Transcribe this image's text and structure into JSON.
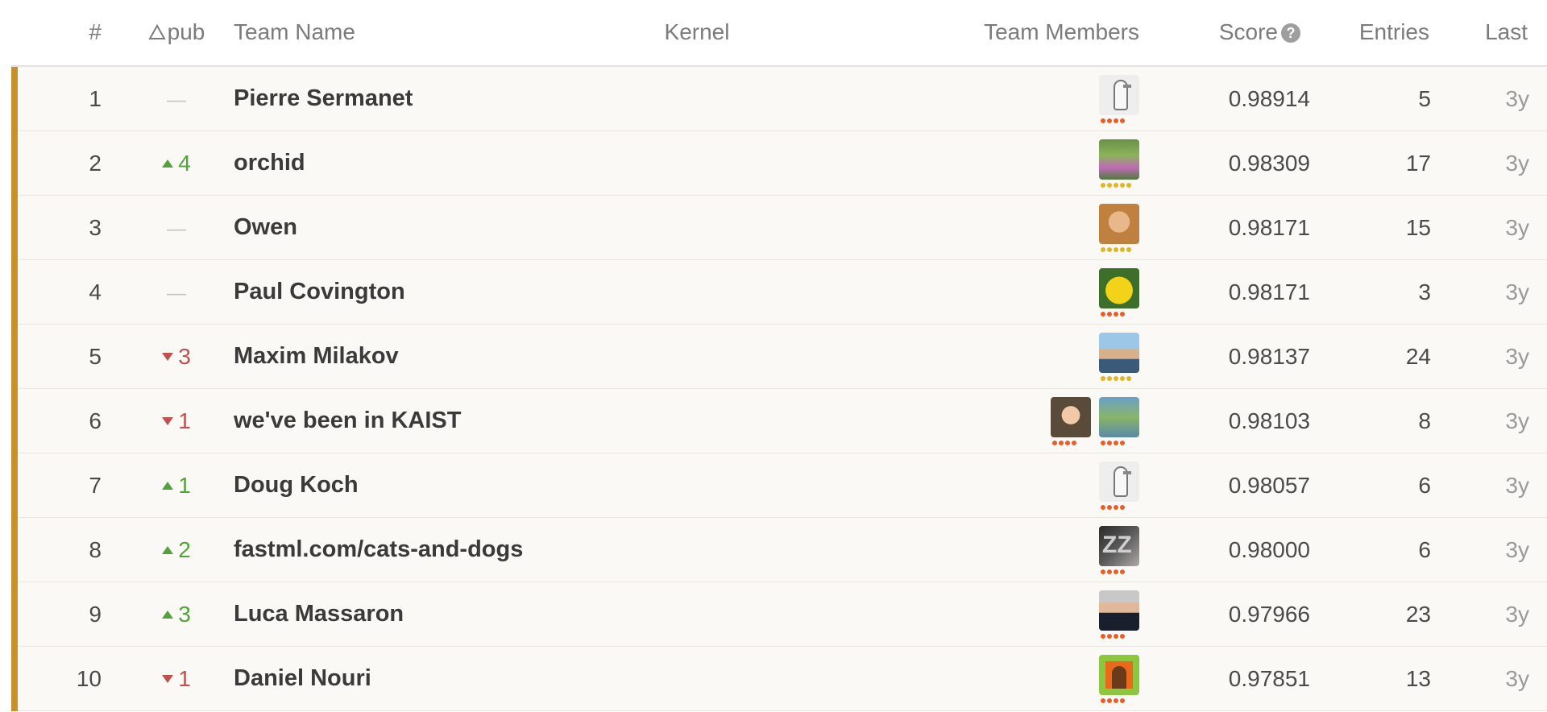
{
  "header": {
    "rank": "#",
    "delta": "pub",
    "team_name": "Team Name",
    "kernel": "Kernel",
    "team_members": "Team Members",
    "score": "Score",
    "entries": "Entries",
    "last": "Last",
    "help_glyph": "?"
  },
  "colors": {
    "gold_highlight": "#c4912a",
    "up": "#52a43a",
    "down": "#c0504d",
    "tier_orange": "#e85d2a",
    "tier_gold": "#e0b526"
  },
  "rows": [
    {
      "rank": "1",
      "delta_dir": "none",
      "delta": "—",
      "team": "Pierre Sermanet",
      "score": "0.98914",
      "entries": "5",
      "last": "3y",
      "members": [
        {
          "avatar": "goose",
          "tier": "orange"
        }
      ]
    },
    {
      "rank": "2",
      "delta_dir": "up",
      "delta": "4",
      "team": "orchid",
      "score": "0.98309",
      "entries": "17",
      "last": "3y",
      "members": [
        {
          "avatar": "orchid",
          "tier": "gold"
        }
      ]
    },
    {
      "rank": "3",
      "delta_dir": "none",
      "delta": "—",
      "team": "Owen",
      "score": "0.98171",
      "entries": "15",
      "last": "3y",
      "members": [
        {
          "avatar": "owen",
          "tier": "gold"
        }
      ]
    },
    {
      "rank": "4",
      "delta_dir": "none",
      "delta": "—",
      "team": "Paul Covington",
      "score": "0.98171",
      "entries": "3",
      "last": "3y",
      "members": [
        {
          "avatar": "bigbird",
          "tier": "orange"
        }
      ]
    },
    {
      "rank": "5",
      "delta_dir": "down",
      "delta": "3",
      "team": "Maxim Milakov",
      "score": "0.98137",
      "entries": "24",
      "last": "3y",
      "members": [
        {
          "avatar": "maxim",
          "tier": "gold"
        }
      ]
    },
    {
      "rank": "6",
      "delta_dir": "down",
      "delta": "1",
      "team": "we've been in KAIST",
      "score": "0.98103",
      "entries": "8",
      "last": "3y",
      "members": [
        {
          "avatar": "kaist1",
          "tier": "orange"
        },
        {
          "avatar": "kaist2",
          "tier": "orange"
        }
      ]
    },
    {
      "rank": "7",
      "delta_dir": "up",
      "delta": "1",
      "team": "Doug Koch",
      "score": "0.98057",
      "entries": "6",
      "last": "3y",
      "members": [
        {
          "avatar": "goose",
          "tier": "orange"
        }
      ]
    },
    {
      "rank": "8",
      "delta_dir": "up",
      "delta": "2",
      "team": "fastml.com/cats-and-dogs",
      "score": "0.98000",
      "entries": "6",
      "last": "3y",
      "members": [
        {
          "avatar": "zz",
          "tier": "orange"
        }
      ]
    },
    {
      "rank": "9",
      "delta_dir": "up",
      "delta": "3",
      "team": "Luca Massaron",
      "score": "0.97966",
      "entries": "23",
      "last": "3y",
      "members": [
        {
          "avatar": "luca",
          "tier": "orange"
        }
      ]
    },
    {
      "rank": "10",
      "delta_dir": "down",
      "delta": "1",
      "team": "Daniel Nouri",
      "score": "0.97851",
      "entries": "13",
      "last": "3y",
      "members": [
        {
          "avatar": "daniel",
          "tier": "orange"
        }
      ]
    }
  ]
}
